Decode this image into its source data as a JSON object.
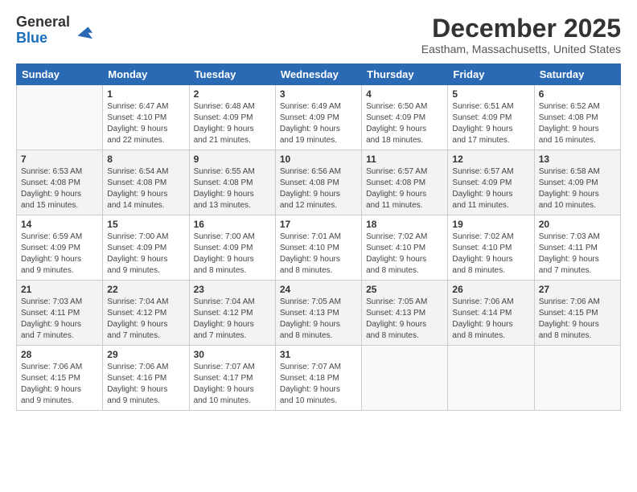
{
  "logo": {
    "general": "General",
    "blue": "Blue"
  },
  "title": "December 2025",
  "subtitle": "Eastham, Massachusetts, United States",
  "days_of_week": [
    "Sunday",
    "Monday",
    "Tuesday",
    "Wednesday",
    "Thursday",
    "Friday",
    "Saturday"
  ],
  "weeks": [
    [
      {
        "day": "",
        "info": ""
      },
      {
        "day": "1",
        "info": "Sunrise: 6:47 AM\nSunset: 4:10 PM\nDaylight: 9 hours\nand 22 minutes."
      },
      {
        "day": "2",
        "info": "Sunrise: 6:48 AM\nSunset: 4:09 PM\nDaylight: 9 hours\nand 21 minutes."
      },
      {
        "day": "3",
        "info": "Sunrise: 6:49 AM\nSunset: 4:09 PM\nDaylight: 9 hours\nand 19 minutes."
      },
      {
        "day": "4",
        "info": "Sunrise: 6:50 AM\nSunset: 4:09 PM\nDaylight: 9 hours\nand 18 minutes."
      },
      {
        "day": "5",
        "info": "Sunrise: 6:51 AM\nSunset: 4:09 PM\nDaylight: 9 hours\nand 17 minutes."
      },
      {
        "day": "6",
        "info": "Sunrise: 6:52 AM\nSunset: 4:08 PM\nDaylight: 9 hours\nand 16 minutes."
      }
    ],
    [
      {
        "day": "7",
        "info": "Sunrise: 6:53 AM\nSunset: 4:08 PM\nDaylight: 9 hours\nand 15 minutes."
      },
      {
        "day": "8",
        "info": "Sunrise: 6:54 AM\nSunset: 4:08 PM\nDaylight: 9 hours\nand 14 minutes."
      },
      {
        "day": "9",
        "info": "Sunrise: 6:55 AM\nSunset: 4:08 PM\nDaylight: 9 hours\nand 13 minutes."
      },
      {
        "day": "10",
        "info": "Sunrise: 6:56 AM\nSunset: 4:08 PM\nDaylight: 9 hours\nand 12 minutes."
      },
      {
        "day": "11",
        "info": "Sunrise: 6:57 AM\nSunset: 4:08 PM\nDaylight: 9 hours\nand 11 minutes."
      },
      {
        "day": "12",
        "info": "Sunrise: 6:57 AM\nSunset: 4:09 PM\nDaylight: 9 hours\nand 11 minutes."
      },
      {
        "day": "13",
        "info": "Sunrise: 6:58 AM\nSunset: 4:09 PM\nDaylight: 9 hours\nand 10 minutes."
      }
    ],
    [
      {
        "day": "14",
        "info": "Sunrise: 6:59 AM\nSunset: 4:09 PM\nDaylight: 9 hours\nand 9 minutes."
      },
      {
        "day": "15",
        "info": "Sunrise: 7:00 AM\nSunset: 4:09 PM\nDaylight: 9 hours\nand 9 minutes."
      },
      {
        "day": "16",
        "info": "Sunrise: 7:00 AM\nSunset: 4:09 PM\nDaylight: 9 hours\nand 8 minutes."
      },
      {
        "day": "17",
        "info": "Sunrise: 7:01 AM\nSunset: 4:10 PM\nDaylight: 9 hours\nand 8 minutes."
      },
      {
        "day": "18",
        "info": "Sunrise: 7:02 AM\nSunset: 4:10 PM\nDaylight: 9 hours\nand 8 minutes."
      },
      {
        "day": "19",
        "info": "Sunrise: 7:02 AM\nSunset: 4:10 PM\nDaylight: 9 hours\nand 8 minutes."
      },
      {
        "day": "20",
        "info": "Sunrise: 7:03 AM\nSunset: 4:11 PM\nDaylight: 9 hours\nand 7 minutes."
      }
    ],
    [
      {
        "day": "21",
        "info": "Sunrise: 7:03 AM\nSunset: 4:11 PM\nDaylight: 9 hours\nand 7 minutes."
      },
      {
        "day": "22",
        "info": "Sunrise: 7:04 AM\nSunset: 4:12 PM\nDaylight: 9 hours\nand 7 minutes."
      },
      {
        "day": "23",
        "info": "Sunrise: 7:04 AM\nSunset: 4:12 PM\nDaylight: 9 hours\nand 7 minutes."
      },
      {
        "day": "24",
        "info": "Sunrise: 7:05 AM\nSunset: 4:13 PM\nDaylight: 9 hours\nand 8 minutes."
      },
      {
        "day": "25",
        "info": "Sunrise: 7:05 AM\nSunset: 4:13 PM\nDaylight: 9 hours\nand 8 minutes."
      },
      {
        "day": "26",
        "info": "Sunrise: 7:06 AM\nSunset: 4:14 PM\nDaylight: 9 hours\nand 8 minutes."
      },
      {
        "day": "27",
        "info": "Sunrise: 7:06 AM\nSunset: 4:15 PM\nDaylight: 9 hours\nand 8 minutes."
      }
    ],
    [
      {
        "day": "28",
        "info": "Sunrise: 7:06 AM\nSunset: 4:15 PM\nDaylight: 9 hours\nand 9 minutes."
      },
      {
        "day": "29",
        "info": "Sunrise: 7:06 AM\nSunset: 4:16 PM\nDaylight: 9 hours\nand 9 minutes."
      },
      {
        "day": "30",
        "info": "Sunrise: 7:07 AM\nSunset: 4:17 PM\nDaylight: 9 hours\nand 10 minutes."
      },
      {
        "day": "31",
        "info": "Sunrise: 7:07 AM\nSunset: 4:18 PM\nDaylight: 9 hours\nand 10 minutes."
      },
      {
        "day": "",
        "info": ""
      },
      {
        "day": "",
        "info": ""
      },
      {
        "day": "",
        "info": ""
      }
    ]
  ]
}
